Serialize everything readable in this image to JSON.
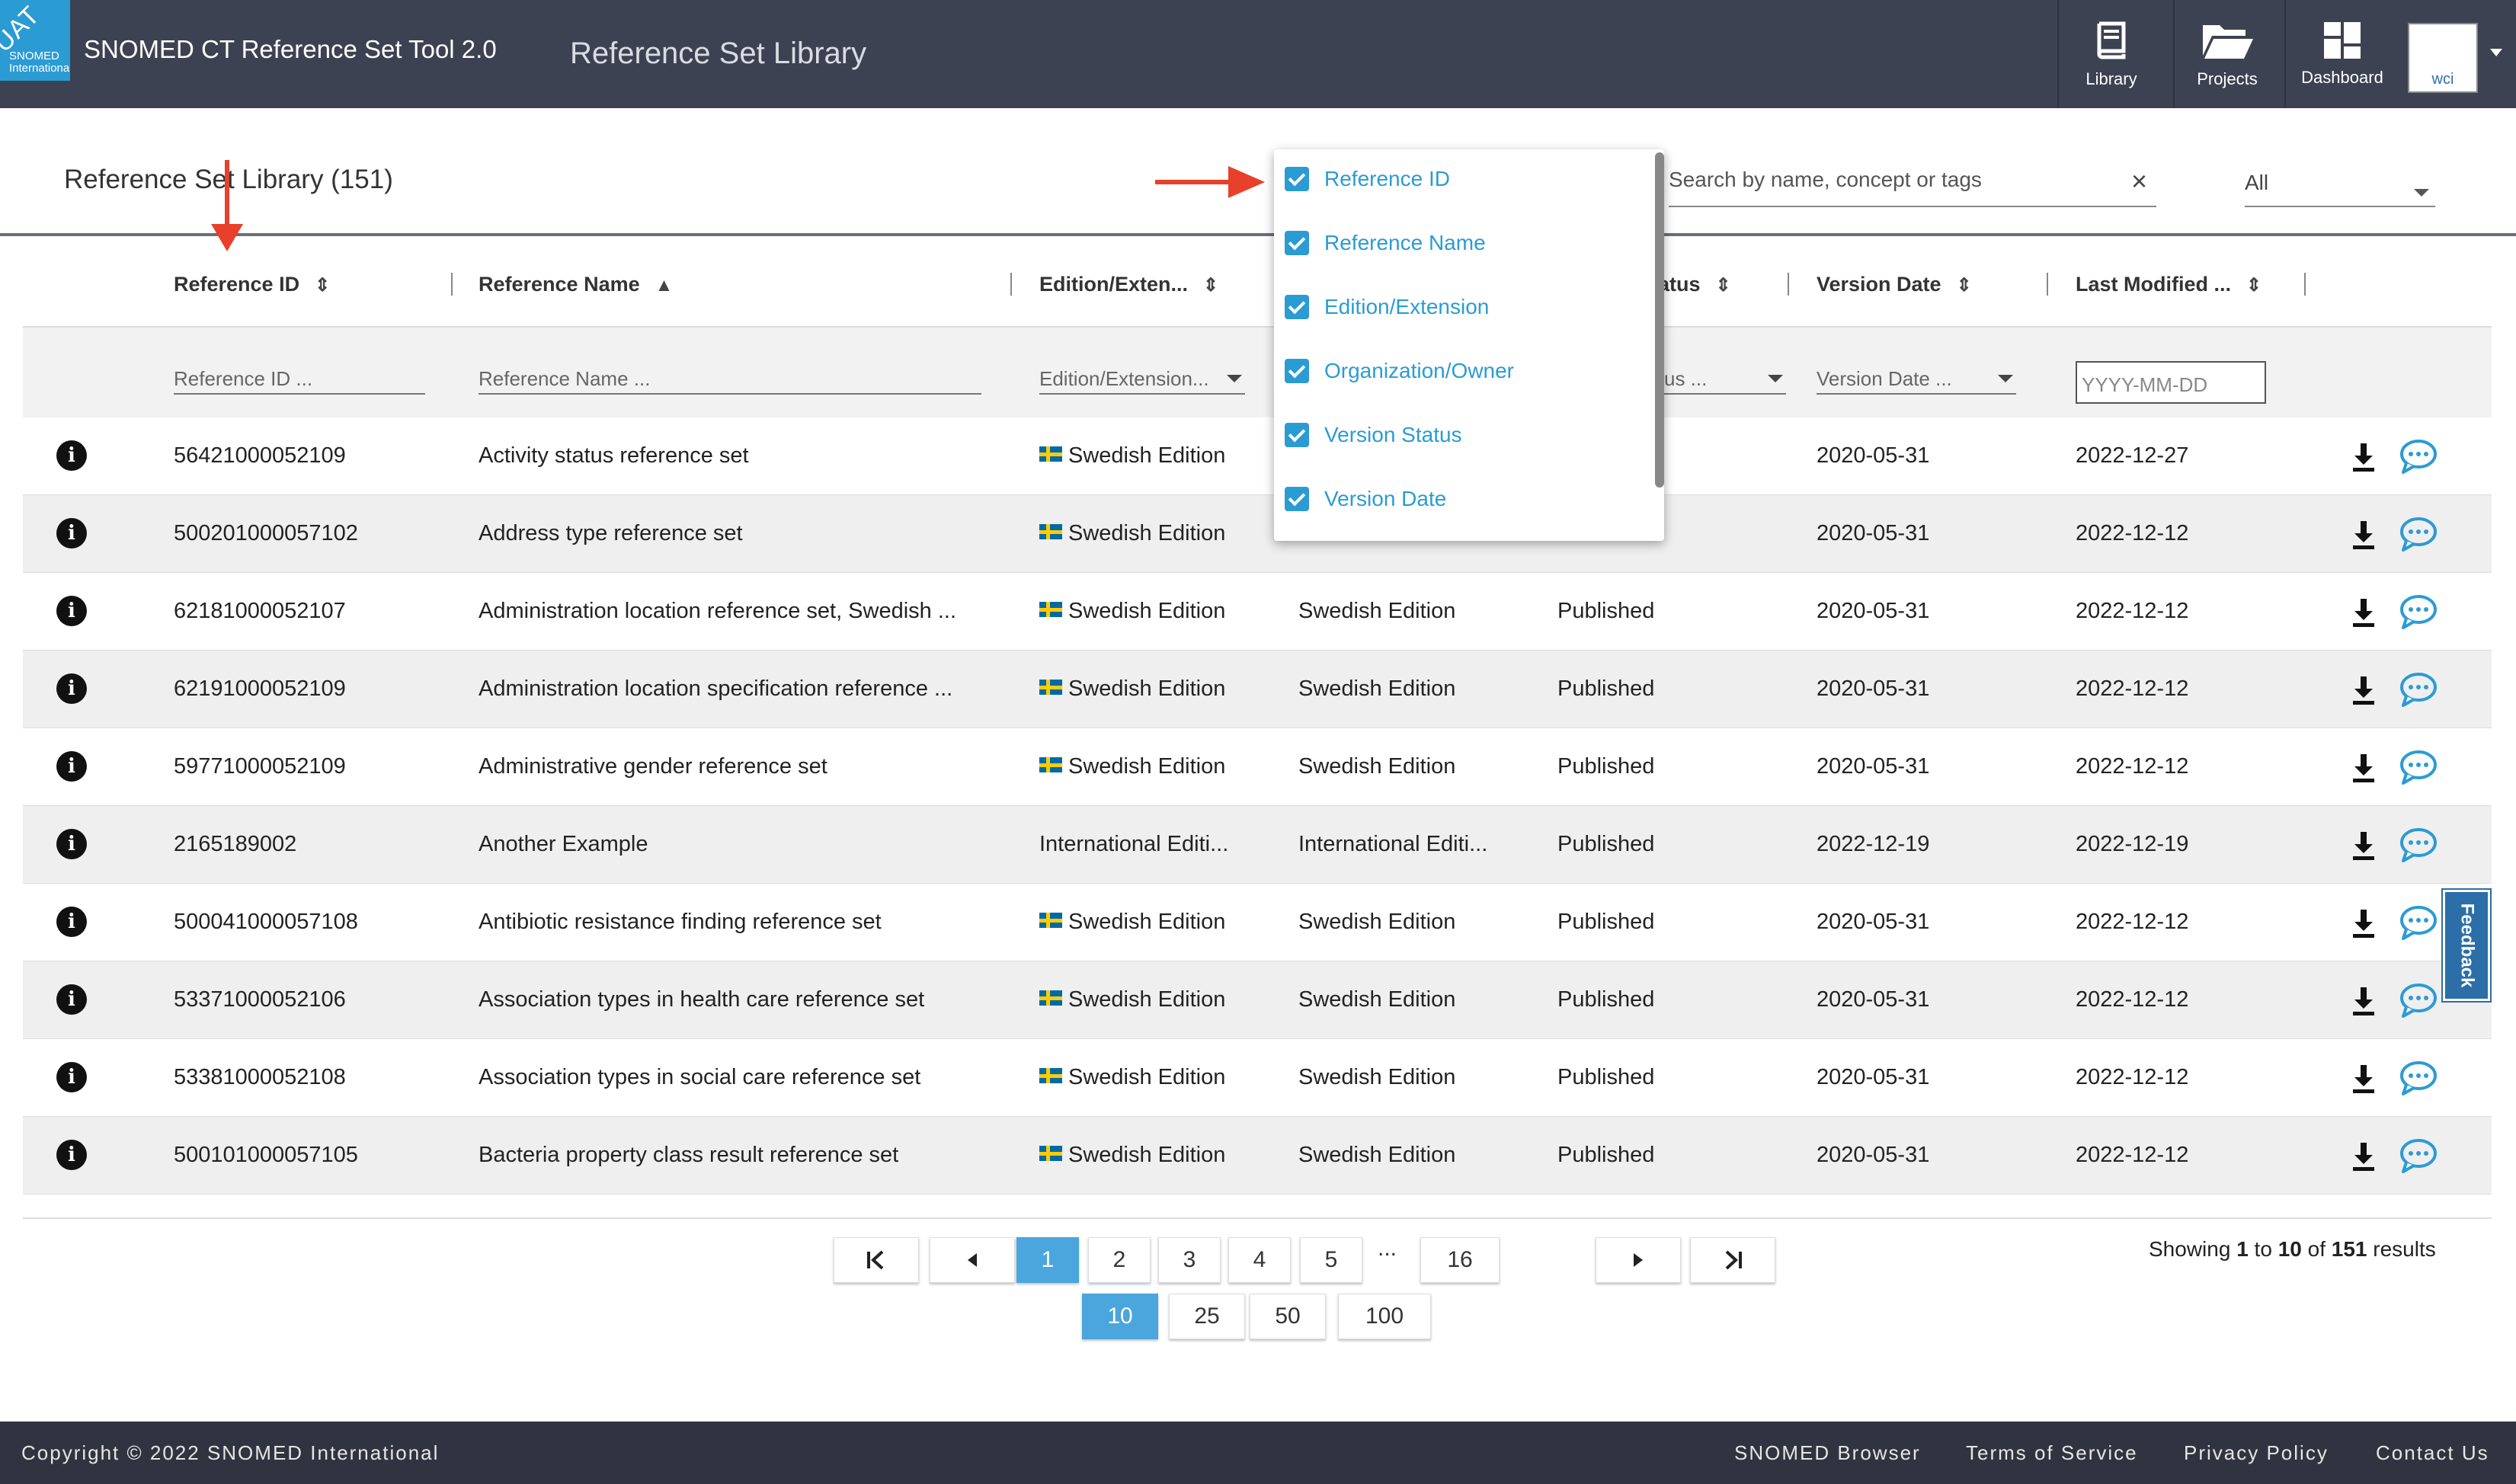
{
  "header": {
    "uat_badge": "UAT",
    "logo_text": "SNOMED International",
    "app_title": "SNOMED CT Reference Set Tool 2.0",
    "page_heading": "Reference Set Library",
    "nav": [
      {
        "label": "Library",
        "icon": "book-icon"
      },
      {
        "label": "Projects",
        "icon": "folder-open-icon"
      },
      {
        "label": "Dashboard",
        "icon": "dashboard-icon"
      }
    ],
    "user_initials": "wci"
  },
  "library": {
    "title": "Reference Set Library (151)",
    "search_placeholder": "Search by name, concept or tags",
    "filter_value": "All"
  },
  "table": {
    "columns": [
      {
        "label": "Reference ID",
        "sort": "unsorted"
      },
      {
        "label": "Reference Name",
        "sort": "ascending"
      },
      {
        "label": "Edition/Exten...",
        "sort": "unsorted"
      },
      {
        "label": "atus",
        "sort": "unsorted"
      },
      {
        "label": "Version Date",
        "sort": "unsorted"
      },
      {
        "label": "Last Modified ...",
        "sort": "unsorted"
      }
    ],
    "filters": {
      "reference_id": "Reference ID ...",
      "reference_name": "Reference Name ...",
      "edition": "Edition/Extension...",
      "status": "us ...",
      "version_date": "Version Date ...",
      "last_modified": "YYYY-MM-DD"
    },
    "rows": [
      {
        "id": "56421000052109",
        "name": "Activity status reference set",
        "edition": "Swedish Edition",
        "flag": true,
        "org": "",
        "status": "",
        "version_date": "2020-05-31",
        "last_modified": "2022-12-27"
      },
      {
        "id": "500201000057102",
        "name": "Address type reference set",
        "edition": "Swedish Edition",
        "flag": true,
        "org": "",
        "status": "",
        "version_date": "2020-05-31",
        "last_modified": "2022-12-12"
      },
      {
        "id": "62181000052107",
        "name": "Administration location reference set, Swedish ...",
        "edition": "Swedish Edition",
        "flag": true,
        "org": "Swedish Edition",
        "status": "Published",
        "version_date": "2020-05-31",
        "last_modified": "2022-12-12"
      },
      {
        "id": "62191000052109",
        "name": "Administration location specification reference ...",
        "edition": "Swedish Edition",
        "flag": true,
        "org": "Swedish Edition",
        "status": "Published",
        "version_date": "2020-05-31",
        "last_modified": "2022-12-12"
      },
      {
        "id": "59771000052109",
        "name": "Administrative gender reference set",
        "edition": "Swedish Edition",
        "flag": true,
        "org": "Swedish Edition",
        "status": "Published",
        "version_date": "2020-05-31",
        "last_modified": "2022-12-12"
      },
      {
        "id": "2165189002",
        "name": "Another Example",
        "edition": "International Editi...",
        "flag": false,
        "org": "International Editi...",
        "status": "Published",
        "version_date": "2022-12-19",
        "last_modified": "2022-12-19"
      },
      {
        "id": "500041000057108",
        "name": "Antibiotic resistance finding reference set",
        "edition": "Swedish Edition",
        "flag": true,
        "org": "Swedish Edition",
        "status": "Published",
        "version_date": "2020-05-31",
        "last_modified": "2022-12-12"
      },
      {
        "id": "53371000052106",
        "name": "Association types in health care reference set",
        "edition": "Swedish Edition",
        "flag": true,
        "org": "Swedish Edition",
        "status": "Published",
        "version_date": "2020-05-31",
        "last_modified": "2022-12-12"
      },
      {
        "id": "53381000052108",
        "name": "Association types in social care reference set",
        "edition": "Swedish Edition",
        "flag": true,
        "org": "Swedish Edition",
        "status": "Published",
        "version_date": "2020-05-31",
        "last_modified": "2022-12-12"
      },
      {
        "id": "500101000057105",
        "name": "Bacteria property class result reference set",
        "edition": "Swedish Edition",
        "flag": true,
        "org": "Swedish Edition",
        "status": "Published",
        "version_date": "2020-05-31",
        "last_modified": "2022-12-12"
      }
    ]
  },
  "column_menu": {
    "items": [
      {
        "label": "Reference ID",
        "checked": true
      },
      {
        "label": "Reference Name",
        "checked": true
      },
      {
        "label": "Edition/Extension",
        "checked": true
      },
      {
        "label": "Organization/Owner",
        "checked": true
      },
      {
        "label": "Version Status",
        "checked": true
      },
      {
        "label": "Version Date",
        "checked": true
      }
    ]
  },
  "feedback_label": "Feedback",
  "pagination": {
    "pages": [
      "1",
      "2",
      "3",
      "4",
      "5",
      "...",
      "16"
    ],
    "current_page": "1",
    "page_sizes": [
      "10",
      "25",
      "50",
      "100"
    ],
    "current_size": "10",
    "showing_prefix": "Showing",
    "from": "1",
    "to_word": "to",
    "to": "10",
    "of_word": "of",
    "total": "151",
    "suffix": "results"
  },
  "footer": {
    "copyright": "Copyright © 2022 SNOMED International",
    "links": [
      "SNOMED Browser",
      "Terms of Service",
      "Privacy Policy",
      "Contact Us"
    ]
  },
  "colors": {
    "header_bg": "#3c4252",
    "accent": "#2b9bd4",
    "annotation_arrow": "#e8402a",
    "footer_bg": "#2f3440"
  }
}
